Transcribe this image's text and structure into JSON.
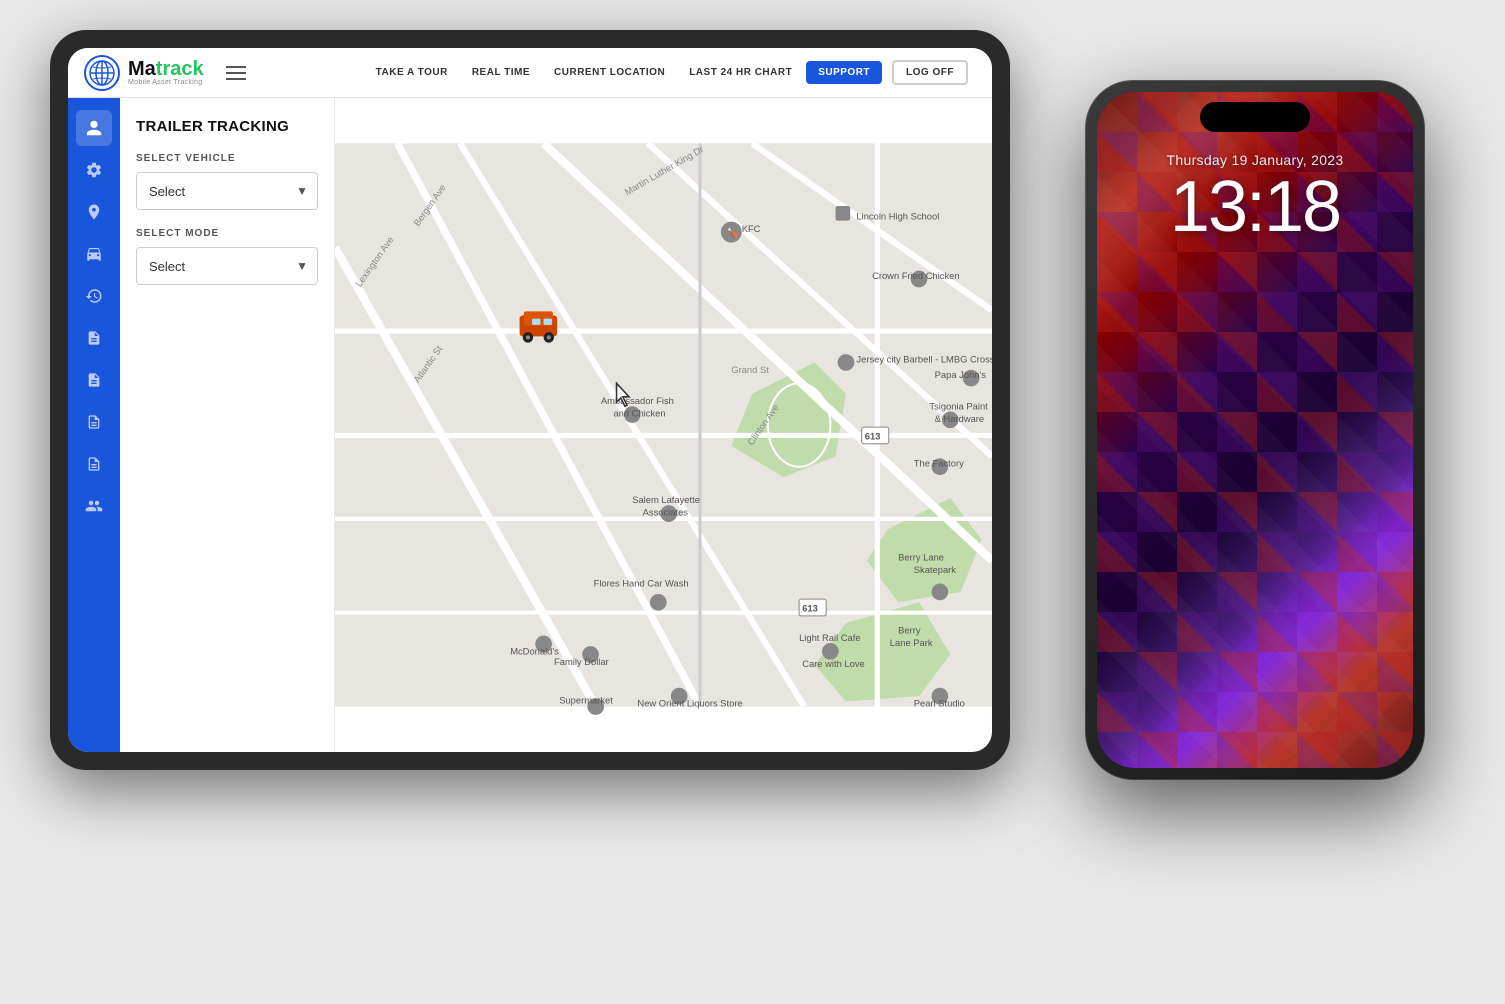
{
  "tablet": {
    "nav": {
      "logoText": "Ma",
      "logoSpan": "track",
      "logoSub": "Mobile Asset Tracking",
      "links": [
        {
          "label": "TAKE A TOUR",
          "id": "take-a-tour"
        },
        {
          "label": "REAL TIME",
          "id": "real-time"
        },
        {
          "label": "CURRENT LOCATION",
          "id": "current-location"
        },
        {
          "label": "LAST 24 HR CHART",
          "id": "last-24hr"
        }
      ],
      "supportBtn": "SUPPORT",
      "logoffBtn": "LOG OFF"
    },
    "sidebar": {
      "icons": [
        {
          "name": "user-icon",
          "symbol": "👤"
        },
        {
          "name": "settings-icon",
          "symbol": "⚙"
        },
        {
          "name": "location-icon",
          "symbol": "📍"
        },
        {
          "name": "tracking-icon",
          "symbol": "🚗"
        },
        {
          "name": "history-icon",
          "symbol": "🕐"
        },
        {
          "name": "report1-icon",
          "symbol": "📋"
        },
        {
          "name": "report2-icon",
          "symbol": "📄"
        },
        {
          "name": "report3-icon",
          "symbol": "📑"
        },
        {
          "name": "report4-icon",
          "symbol": "📃"
        },
        {
          "name": "users-icon",
          "symbol": "👥"
        }
      ]
    },
    "leftPanel": {
      "title": "TRAILER TRACKING",
      "vehicleLabel": "SELECT VEHICLE",
      "vehiclePlaceholder": "Select",
      "modeLabel": "SELECT MODE",
      "modePlaceholder": "Select"
    }
  },
  "phone": {
    "date": "Thursday 19 January, 2023",
    "time": "13:18"
  }
}
